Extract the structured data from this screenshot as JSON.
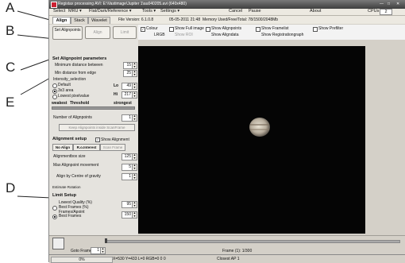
{
  "annotations": {
    "a": "A",
    "b": "B",
    "c": "C",
    "d": "D",
    "e": "E"
  },
  "window": {
    "title": "Registax processing AVI: E:\\Vastimage\\Jupiter 1\\au040205.avi (640x480)"
  },
  "menu": {
    "select": "Select",
    "mru": "MRU ▾",
    "flat": "Flat/Dark/Reference ▾",
    "tools": "Tools ▾",
    "settings": "Settings ▾",
    "cancel": "Cancel",
    "pause": "Pause",
    "about": "About",
    "cpus_label": "CPUs",
    "cpus_value": "2"
  },
  "tabs": {
    "align": "Align",
    "stack": "Stack",
    "wavelet": "Wavelet"
  },
  "fileinfo": {
    "version": "File Version: 6.1.0.8",
    "date": "05-05-2011 21:48",
    "memory": "Memory Used/Free/Total: 78/1500/2048Mb"
  },
  "buttons": {
    "set_alignpoints": "Set Alignpoints",
    "align": "Align",
    "limit": "Limit"
  },
  "options": {
    "colour": "Colour",
    "lrgb": "LRGB",
    "show_full_image": "Show Full image",
    "show_roi": "Show ROI",
    "show_alignpoints": "Show Alignpoints",
    "show_aligndata": "Show Aligndata",
    "show_framelist": "Show Framelist",
    "show_registrationgraph": "Show Registrationgraph",
    "show_prefilter": "Show Prefilter"
  },
  "alignpoint_params": {
    "header": "Set Alignpoint parameters",
    "min_distance_label": "Minimum distance between",
    "min_distance_value": "15",
    "min_edge_label": "Min distance from edge",
    "min_edge_value": "25",
    "intensity_label": "Intensity_selection",
    "default_label": "Default",
    "lo_label": "Lo",
    "lo_value": "49",
    "area_label": "3x3 area",
    "hi_label": "Hi",
    "hi_value": "217",
    "lowest_pixel_label": "Lowest pixelvalue",
    "weakest": "weakest",
    "threshold": "Threshold",
    "strongest": "strongest",
    "num_alignpoints_label": "Number of Alignpoints",
    "num_alignpoints_value": "1",
    "keep_label": "Keep Alignpoints inside ScanFrame"
  },
  "alignment_setup": {
    "header": "Alignment setup",
    "show_alignment": "Show Alignment",
    "no_align": "No Align",
    "rx_interest": "R.o.Interest",
    "scanframe": "Scan Frame",
    "box_size_label": "Alignmentbox size",
    "box_size_value": "125",
    "max_move_label": "Max Alignpoint movement",
    "max_move_value": "5",
    "centre_label": "Align by Centre of gravity",
    "centre_value": "1",
    "estimate_rotation": "Estimate Rotation"
  },
  "limit_setup": {
    "header": "Limit Setup",
    "lowest_quality_label": "Lowest Quality (%)",
    "lowest_quality_value": "95",
    "best_frames_pct_label": "Best Frames (%)",
    "frames_apoint_label": "Frames/Apoint",
    "best_frames_label": "Best Frames",
    "best_frames_value": "150"
  },
  "bottom": {
    "goto_label": "Goto Frame",
    "goto_value": "1",
    "frame_counter": "Frame (1): 1/300"
  },
  "status": {
    "progress": "0%",
    "coords": "X=530 Y=433 L=0 RGB=0 0 0",
    "closest": "Closest AP 1"
  }
}
